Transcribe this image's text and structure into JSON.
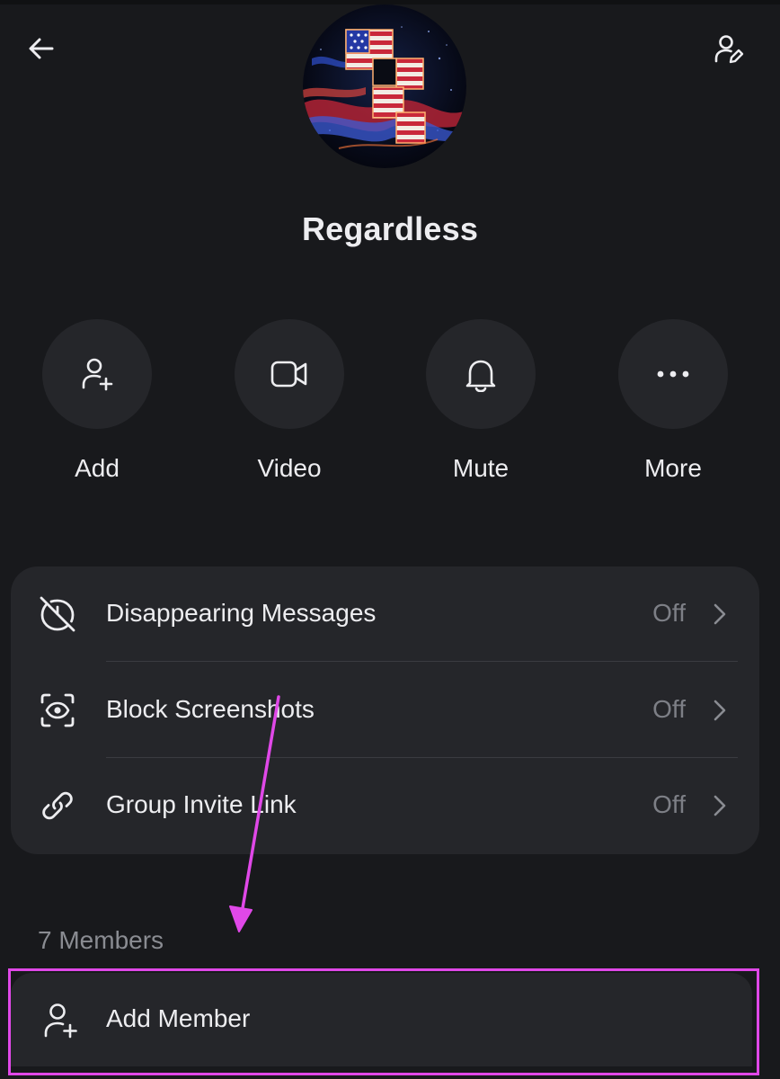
{
  "header": {
    "back_icon": "arrow-left-icon",
    "edit_icon": "user-edit-icon"
  },
  "group": {
    "name": "Regardless",
    "avatar": "american-flag-letter-f-avatar"
  },
  "actions": [
    {
      "label": "Add",
      "icon": "user-plus-icon"
    },
    {
      "label": "Video",
      "icon": "video-camera-icon"
    },
    {
      "label": "Mute",
      "icon": "bell-icon"
    },
    {
      "label": "More",
      "icon": "more-horizontal-icon"
    }
  ],
  "settings": [
    {
      "label": "Disappearing Messages",
      "value": "Off",
      "icon": "timer-off-icon"
    },
    {
      "label": "Block Screenshots",
      "value": "Off",
      "icon": "screenshot-eye-icon"
    },
    {
      "label": "Group Invite Link",
      "value": "Off",
      "icon": "link-icon"
    }
  ],
  "members": {
    "count_label": "7 Members",
    "add_member_label": "Add Member",
    "add_member_icon": "user-plus-icon"
  },
  "colors": {
    "background": "#18191c",
    "surface": "#25262a",
    "text": "#ededf0",
    "muted": "#7d7f86",
    "annotation": "#e048e8"
  }
}
